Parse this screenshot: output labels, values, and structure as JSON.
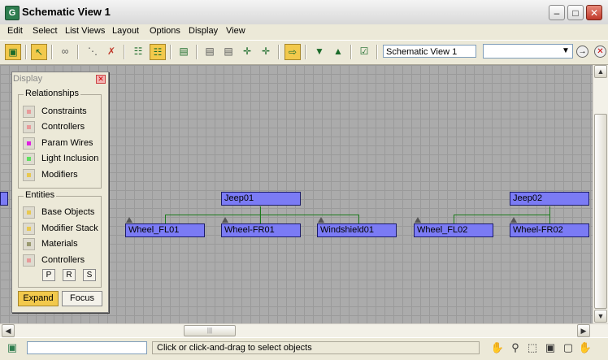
{
  "window": {
    "title": "Schematic View 1",
    "app_icon_glyph": "G"
  },
  "menu": [
    "Edit",
    "Select",
    "List Views",
    "Layout",
    "Options",
    "Display",
    "View"
  ],
  "toolbar": {
    "icons": [
      "display-floater-icon",
      "select-icon",
      "connect-icon",
      "unlink-selected-icon",
      "delete-icon",
      "hierarchy-mode-icon",
      "references-mode-icon",
      "always-arrange-icon",
      "arrange-children-icon",
      "arrange-selected-icon",
      "free-all-icon",
      "free-selected-icon",
      "toggle-visibility-icon",
      "shrink-icon",
      "expand-icon",
      "preferences-icon"
    ],
    "view_name": "Schematic View 1",
    "combo_value": ""
  },
  "display_panel": {
    "title": "Display",
    "relationships_label": "Relationships",
    "relationships": [
      {
        "label": "Constraints",
        "color": "#e89a9a"
      },
      {
        "label": "Controllers",
        "color": "#e89a9a"
      },
      {
        "label": "Param Wires",
        "color": "#e020e0"
      },
      {
        "label": "Light Inclusion",
        "color": "#60e060"
      },
      {
        "label": "Modifiers",
        "color": "#e8c850"
      }
    ],
    "entities_label": "Entities",
    "entities": [
      {
        "label": "Base Objects",
        "color": "#e8c850"
      },
      {
        "label": "Modifier Stack",
        "color": "#e8c850"
      },
      {
        "label": "Materials",
        "color": "#9a9a70"
      },
      {
        "label": "Controllers",
        "color": "#e89a9a"
      }
    ],
    "mini_buttons": [
      "P",
      "R",
      "S"
    ],
    "expand_label": "Expand",
    "focus_label": "Focus"
  },
  "nodes": {
    "jeep01": "Jeep01",
    "jeep02": "Jeep02",
    "wheel_fl01": "Wheel_FL01",
    "wheel_fr01": "Wheel-FR01",
    "windshield01": "Windshield01",
    "wheel_fl02": "Wheel_FL02",
    "wheel_fr02": "Wheel-FR02"
  },
  "status": {
    "hint": "Click or click-and-drag to select objects",
    "field_value": "",
    "icons": [
      "pan-icon",
      "zoom-icon",
      "zoom-region-icon",
      "zoom-extents-icon",
      "zoom-extents-selected-icon",
      "pan-to-selected-icon"
    ]
  }
}
